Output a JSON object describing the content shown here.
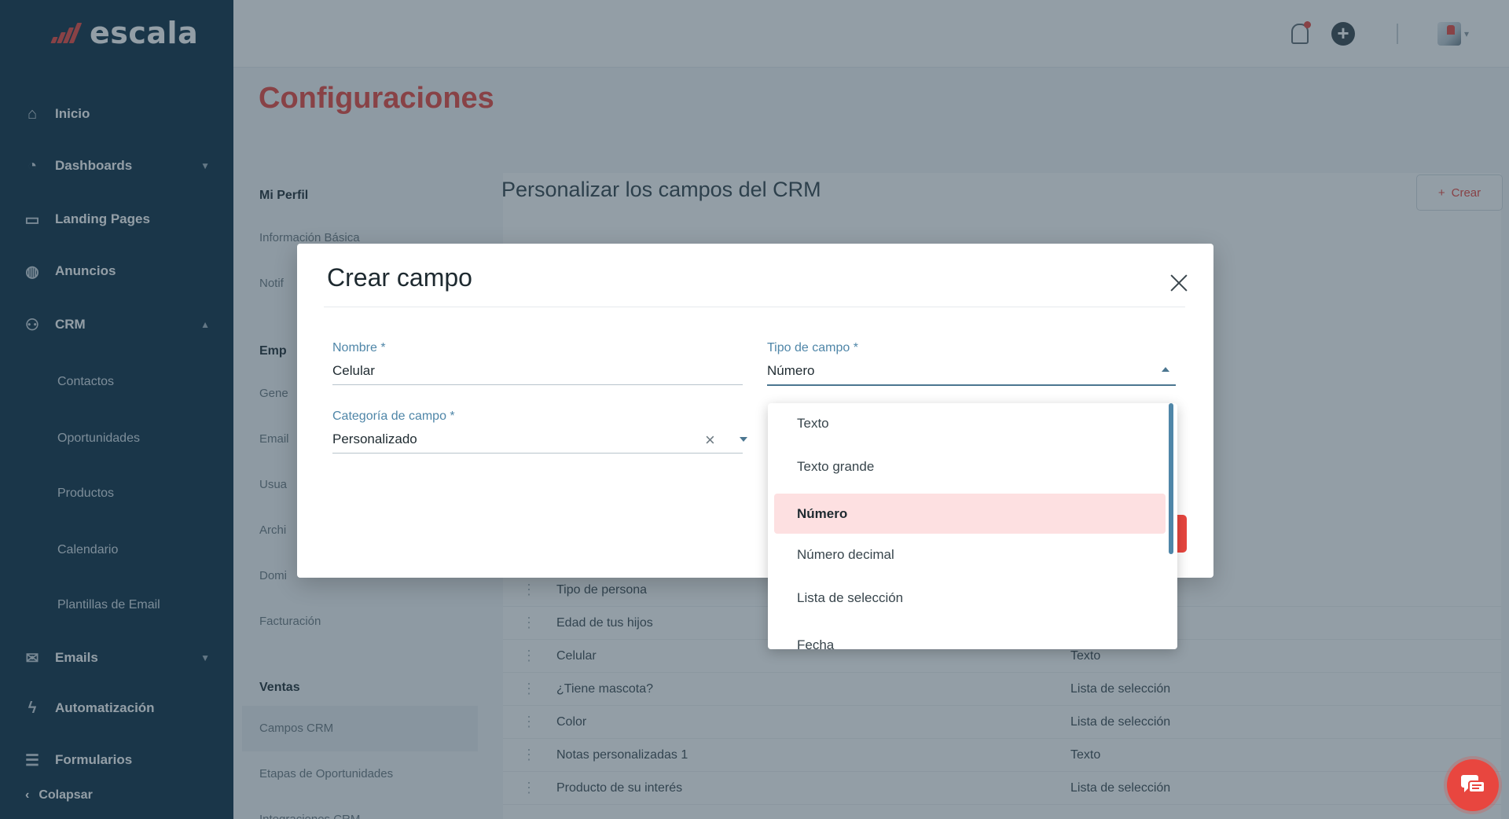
{
  "brand": {
    "logo_text": "escala",
    "accent": "#e8463f",
    "sidebar_bg": "#0c2f45"
  },
  "sidebar": {
    "items": [
      {
        "label": "Inicio",
        "icon": "home-icon"
      },
      {
        "label": "Dashboards",
        "icon": "chart-icon"
      },
      {
        "label": "Landing Pages",
        "icon": "browser-icon"
      },
      {
        "label": "Anuncios",
        "icon": "globe-icon"
      },
      {
        "label": "CRM",
        "icon": "users-icon"
      }
    ],
    "crm_sub": [
      "Contactos",
      "Oportunidades",
      "Productos",
      "Calendario",
      "Plantillas de Email"
    ],
    "items_bottom": [
      {
        "label": "Emails",
        "icon": "mail-icon"
      },
      {
        "label": "Automatización",
        "icon": "bolt-icon"
      },
      {
        "label": "Formularios",
        "icon": "form-icon"
      }
    ],
    "collapse_label": "Colapsar"
  },
  "page": {
    "title": "Configuraciones",
    "panel_title": "Personalizar los campos del CRM",
    "create_button": "Crear"
  },
  "settings_nav": {
    "group_profile": "Mi Perfil",
    "profile_items": [
      "Información Básica",
      "Notif"
    ],
    "group_company": "Emp",
    "company_items": [
      "Gene",
      "Email",
      "Usua",
      "Archi",
      "Domi",
      "Facturación"
    ],
    "group_sales": "Ventas",
    "sales_items": [
      "Campos CRM",
      "Etapas de Oportunidades",
      "Integraciones CRM"
    ]
  },
  "table": {
    "rows": [
      {
        "name": "Tipo de persona",
        "type": ""
      },
      {
        "name": "Edad de tus hijos",
        "type": ""
      },
      {
        "name": "Celular",
        "type": "Texto"
      },
      {
        "name": "¿Tiene mascota?",
        "type": "Lista de selección"
      },
      {
        "name": "Color",
        "type": "Lista de selección"
      },
      {
        "name": "Notas personalizadas 1",
        "type": "Texto"
      },
      {
        "name": "Producto de su interés",
        "type": "Lista de selección"
      }
    ]
  },
  "modal": {
    "title": "Crear campo",
    "fields": {
      "nombre": {
        "label": "Nombre *",
        "value": "Celular"
      },
      "tipo": {
        "label": "Tipo de campo *",
        "value": "Número"
      },
      "categoria": {
        "label": "Categoría de campo *",
        "value": "Personalizado"
      }
    }
  },
  "dropdown": {
    "options": [
      "Texto",
      "Texto grande",
      "Número",
      "Número decimal",
      "Lista de selección",
      "Fecha"
    ],
    "selected": "Número"
  }
}
